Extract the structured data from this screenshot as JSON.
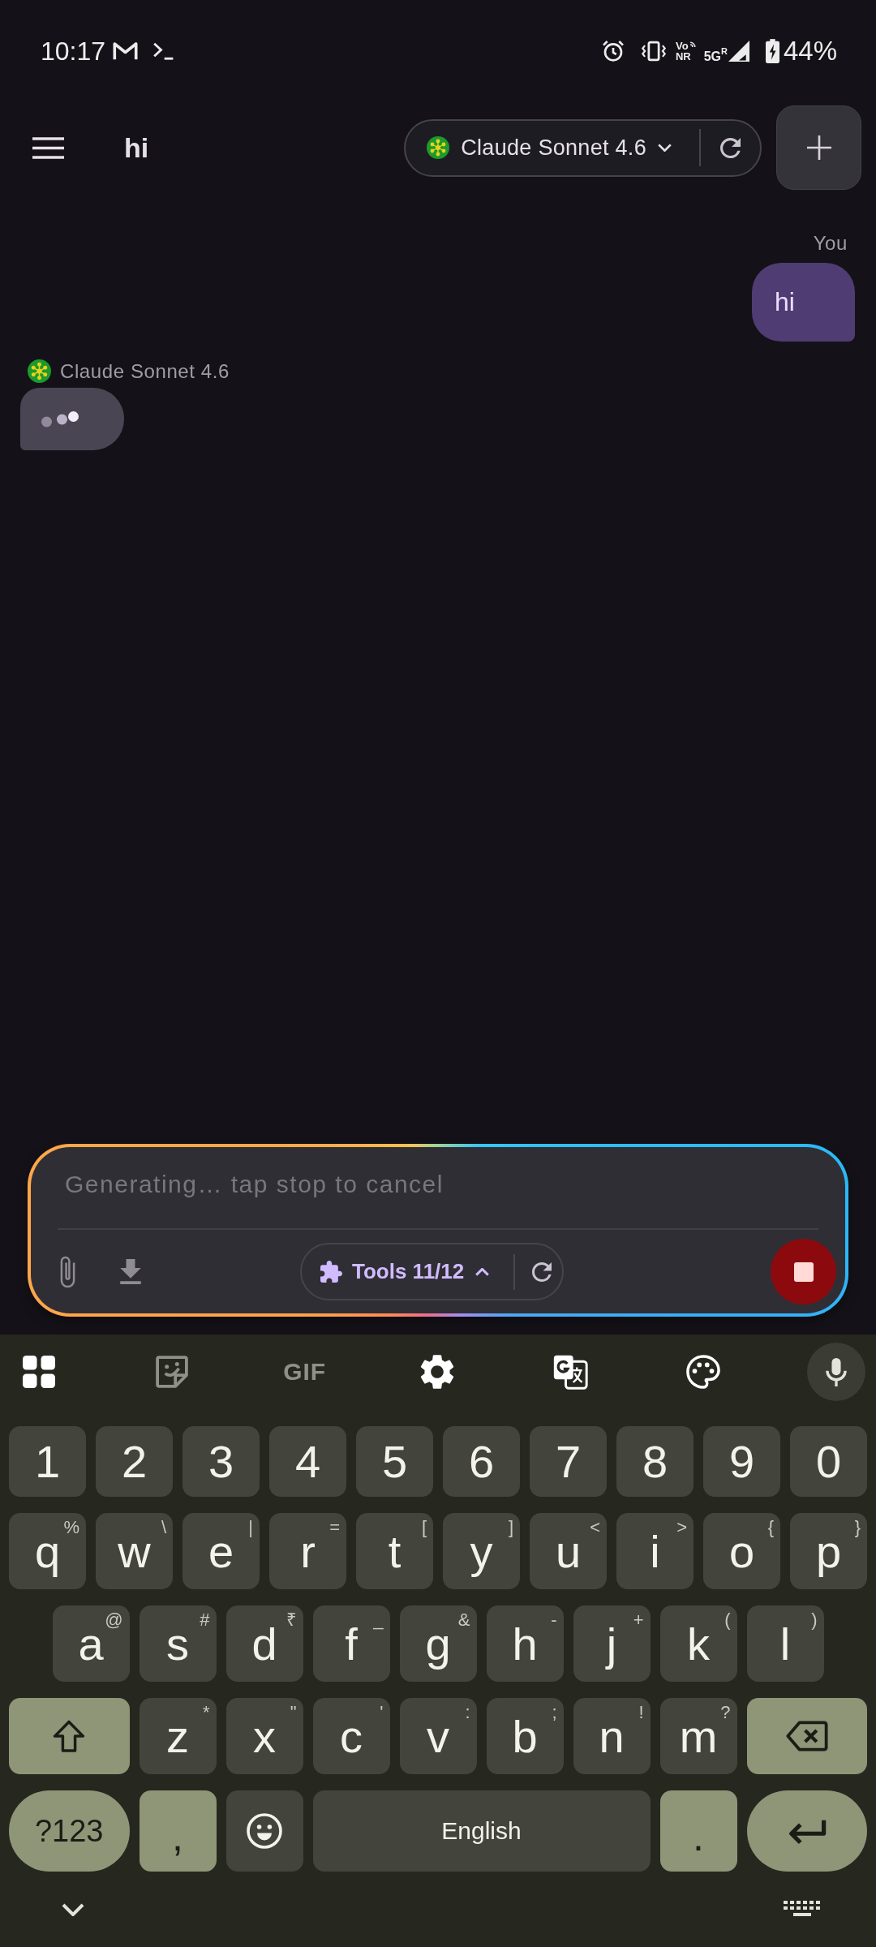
{
  "status_bar": {
    "time": "10:17",
    "vo_label": "Vo",
    "nr_label": "NR",
    "network_type": "5G",
    "roaming_mark": "R",
    "battery": "44%"
  },
  "header": {
    "title": "hi",
    "model": "Claude Sonnet 4.6"
  },
  "messages": [
    {
      "kind": "user",
      "sender": "You",
      "text": "hi"
    },
    {
      "kind": "assistant",
      "sender": "Claude Sonnet 4.6",
      "typing": true
    }
  ],
  "composer": {
    "placeholder": "Generating… tap stop to cancel",
    "generating": true,
    "tools_label": "Tools 11/12"
  },
  "keyboard": {
    "gif_label": "GIF",
    "number_row": [
      "1",
      "2",
      "3",
      "4",
      "5",
      "6",
      "7",
      "8",
      "9",
      "0"
    ],
    "top_row": [
      {
        "kind": "letter",
        "key": "q",
        "hint": "%"
      },
      {
        "kind": "letter",
        "key": "w",
        "hint": "\\"
      },
      {
        "kind": "letter",
        "key": "e",
        "hint": "|"
      },
      {
        "kind": "letter",
        "key": "r",
        "hint": "="
      },
      {
        "kind": "letter",
        "key": "t",
        "hint": "["
      },
      {
        "kind": "letter",
        "key": "y",
        "hint": "]"
      },
      {
        "kind": "letter",
        "key": "u",
        "hint": "<"
      },
      {
        "kind": "letter",
        "key": "i",
        "hint": ">"
      },
      {
        "kind": "letter",
        "key": "o",
        "hint": "{"
      },
      {
        "kind": "letter",
        "key": "p",
        "hint": "}"
      }
    ],
    "middle_row": [
      {
        "kind": "letter",
        "key": "a",
        "hint": "@"
      },
      {
        "kind": "letter",
        "key": "s",
        "hint": "#"
      },
      {
        "kind": "letter",
        "key": "d",
        "hint": "₹"
      },
      {
        "kind": "letter",
        "key": "f",
        "hint": "_"
      },
      {
        "kind": "letter",
        "key": "g",
        "hint": "&"
      },
      {
        "kind": "letter",
        "key": "h",
        "hint": "-"
      },
      {
        "kind": "letter",
        "key": "j",
        "hint": "+"
      },
      {
        "kind": "letter",
        "key": "k",
        "hint": "("
      },
      {
        "kind": "letter",
        "key": "l",
        "hint": ")"
      }
    ],
    "shift_row": [
      {
        "kind": "shift"
      },
      {
        "kind": "letter",
        "key": "z",
        "hint": "*"
      },
      {
        "kind": "letter",
        "key": "x",
        "hint": "\""
      },
      {
        "kind": "letter",
        "key": "c",
        "hint": "'"
      },
      {
        "kind": "letter",
        "key": "v",
        "hint": ":"
      },
      {
        "kind": "letter",
        "key": "b",
        "hint": ";"
      },
      {
        "kind": "letter",
        "key": "n",
        "hint": "!"
      },
      {
        "kind": "letter",
        "key": "m",
        "hint": "?"
      },
      {
        "kind": "backspace"
      }
    ],
    "bottom_row": [
      {
        "kind": "symbols",
        "label": "?123"
      },
      {
        "kind": "punct",
        "label": ","
      },
      {
        "kind": "emoji"
      },
      {
        "kind": "space",
        "label": "English"
      },
      {
        "kind": "punct",
        "label": "."
      },
      {
        "kind": "enter"
      }
    ]
  }
}
